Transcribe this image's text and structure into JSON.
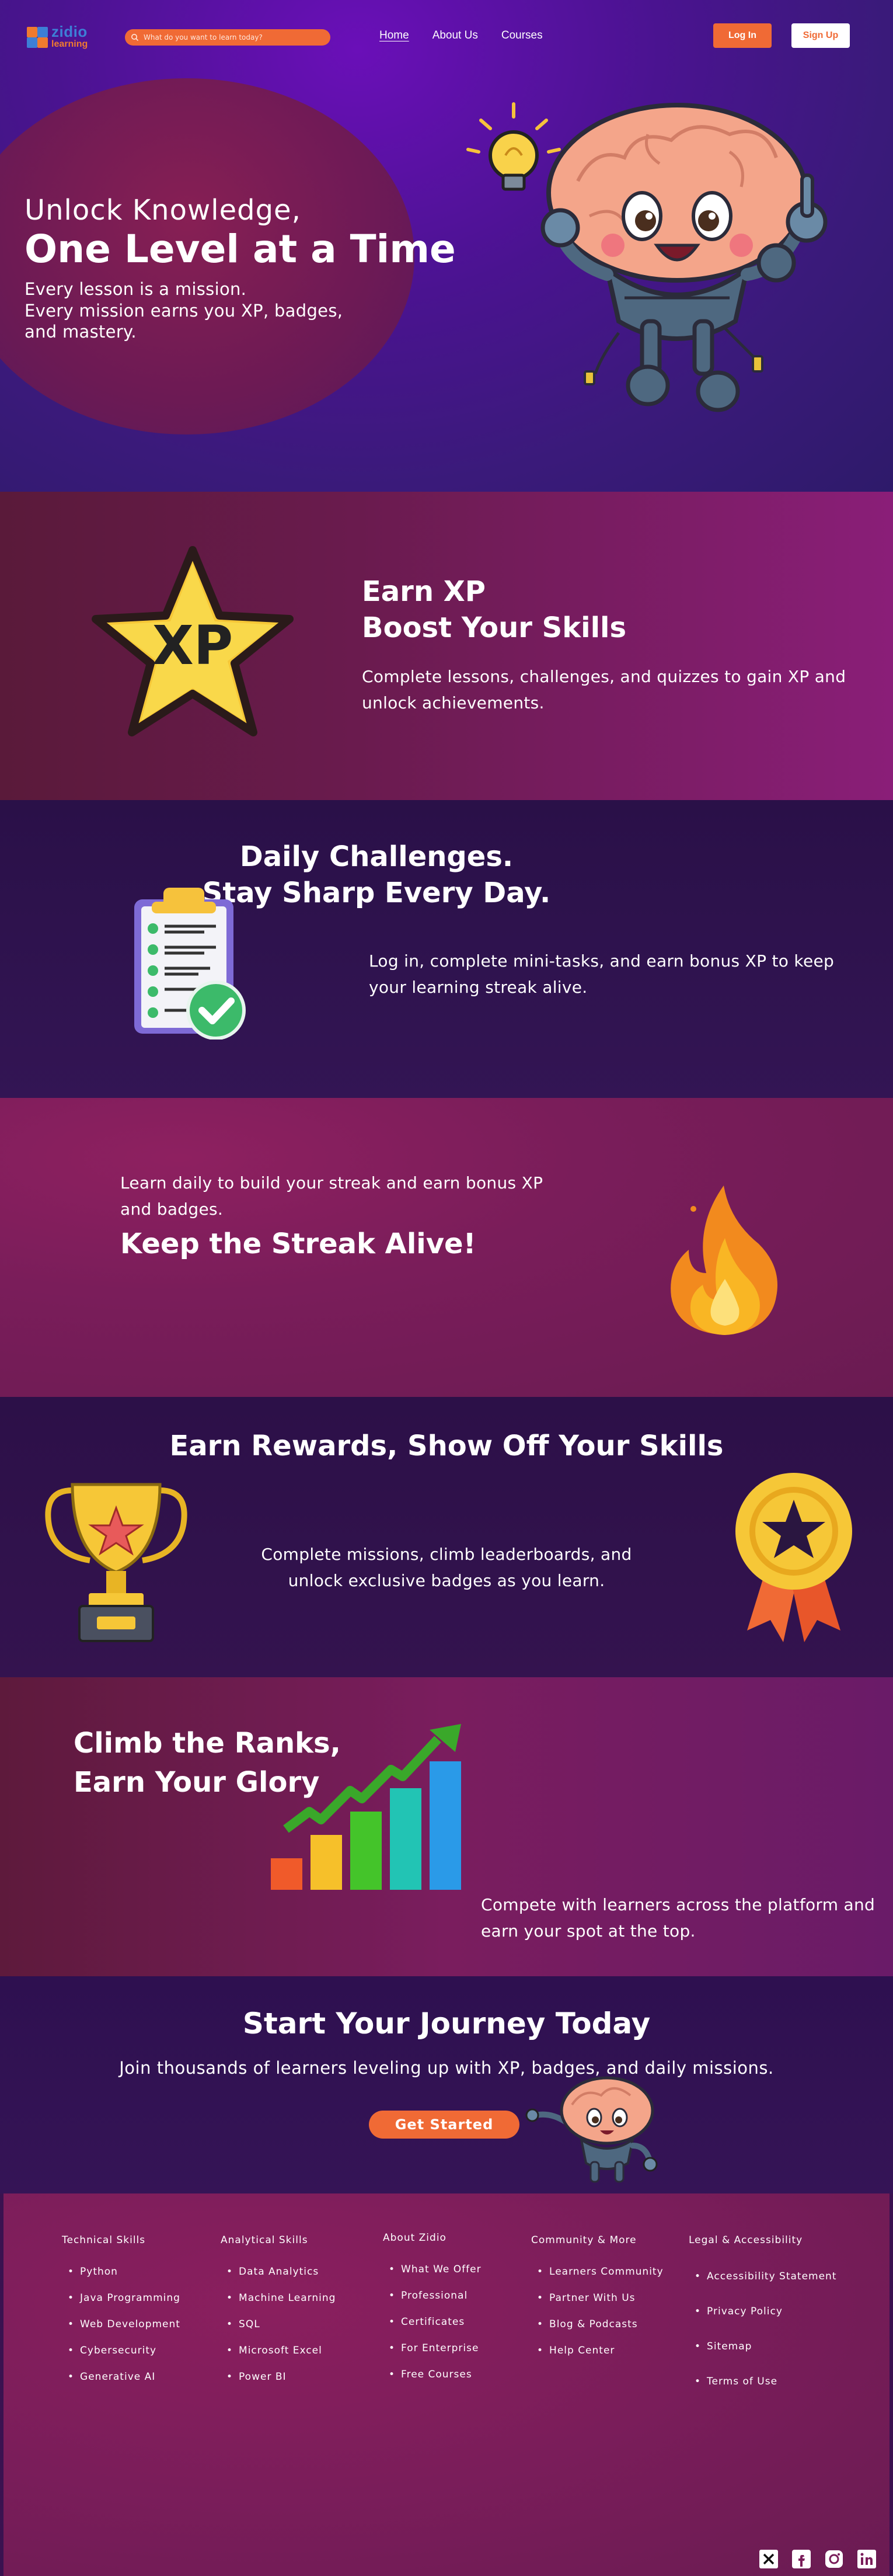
{
  "brand": {
    "line1": "zidio",
    "line2": "learning"
  },
  "search": {
    "placeholder": "What do you want to learn today?"
  },
  "nav": {
    "links": [
      "Home",
      "About Us",
      "Courses"
    ],
    "login": "Log In",
    "signup": "Sign Up"
  },
  "hero": {
    "title_line1": "Unlock Knowledge,",
    "title_line2": "One Level at a Time",
    "desc_line1": "Every lesson is a mission.",
    "desc_line2": "Every mission earns you XP, badges,",
    "desc_line3": "and mastery.",
    "illustration": "brain-robot-mascot with lightbulb-icon"
  },
  "xp": {
    "badge_text": "XP",
    "title_line1": "Earn XP",
    "title_line2": "Boost Your Skills",
    "desc": "Complete lessons, challenges, and quizzes to gain XP and unlock achievements."
  },
  "daily": {
    "title_line1": "Daily Challenges.",
    "title_line2": "Stay Sharp Every Day.",
    "desc": "Log in, complete mini-tasks, and earn bonus XP to keep your learning streak alive.",
    "illustration": "clipboard-checklist-icon"
  },
  "streak": {
    "desc": "Learn daily to build your streak and earn bonus XP and badges.",
    "title": "Keep the Streak Alive!",
    "illustration": "flame-icon"
  },
  "rewards": {
    "title": "Earn Rewards, Show Off Your Skills",
    "desc_line1": "Complete missions, climb leaderboards, and",
    "desc_line2": "unlock exclusive badges as you learn.",
    "left_illustration": "trophy-icon",
    "right_illustration": "medal-ribbon-icon"
  },
  "ranks": {
    "title_line1": "Climb the Ranks,",
    "title_line2": "Earn Your Glory",
    "desc": "Compete with learners across the platform and earn your spot at the top.",
    "illustration": "rising-bar-chart-icon"
  },
  "journey": {
    "title": "Start Your Journey Today",
    "desc": "Join thousands of learners leveling up with XP, badges, and daily missions.",
    "cta": "Get Started"
  },
  "footer": {
    "columns": [
      {
        "heading": "Technical Skills",
        "items": [
          "Python",
          "Java Programming",
          "Web Development",
          "Cybersecurity",
          "Generative AI"
        ]
      },
      {
        "heading": "Analytical Skills",
        "items": [
          "Data Analytics",
          "Machine Learning",
          "SQL",
          "Microsoft Excel",
          "Power BI"
        ]
      },
      {
        "heading": "About Zidio",
        "items": [
          "What We Offer",
          "Professional",
          "Certificates",
          "For Enterprise",
          "Free Courses"
        ]
      },
      {
        "heading": "Community & More",
        "items": [
          "Learners Community",
          "Partner With Us",
          "Blog & Podcasts",
          "Help Center"
        ]
      },
      {
        "heading": "Legal & Accessibility",
        "items": [
          "Accessibility Statement",
          "Privacy Policy",
          "Sitemap",
          "Terms of Use"
        ]
      }
    ],
    "social": [
      "x-icon",
      "facebook-icon",
      "instagram-icon",
      "linkedin-icon"
    ]
  },
  "colors": {
    "accent": "#f06a35",
    "brand_blue": "#3d7fd6",
    "hero_purple": "#4a1390",
    "magenta": "#7a1d5a"
  }
}
